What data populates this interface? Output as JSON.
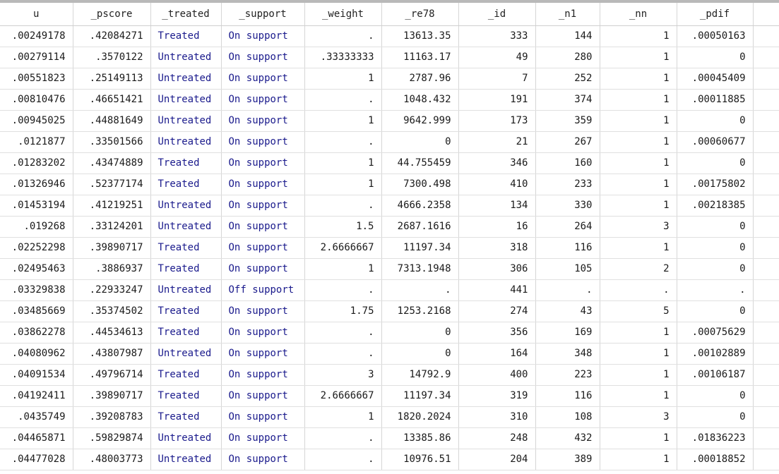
{
  "columns": [
    "u",
    "_pscore",
    "_treated",
    "_support",
    "_weight",
    "_re78",
    "_id",
    "_n1",
    "_nn",
    "_pdif"
  ],
  "rows": [
    [
      ".00249178",
      ".42084271",
      "Treated",
      "On support",
      ".",
      "13613.35",
      "333",
      "144",
      "1",
      ".00050163"
    ],
    [
      ".00279114",
      ".3570122",
      "Untreated",
      "On support",
      ".33333333",
      "11163.17",
      "49",
      "280",
      "1",
      "0"
    ],
    [
      ".00551823",
      ".25149113",
      "Untreated",
      "On support",
      "1",
      "2787.96",
      "7",
      "252",
      "1",
      ".00045409"
    ],
    [
      ".00810476",
      ".46651421",
      "Untreated",
      "On support",
      ".",
      "1048.432",
      "191",
      "374",
      "1",
      ".00011885"
    ],
    [
      ".00945025",
      ".44881649",
      "Untreated",
      "On support",
      "1",
      "9642.999",
      "173",
      "359",
      "1",
      "0"
    ],
    [
      ".0121877",
      ".33501566",
      "Untreated",
      "On support",
      ".",
      "0",
      "21",
      "267",
      "1",
      ".00060677"
    ],
    [
      ".01283202",
      ".43474889",
      "Treated",
      "On support",
      "1",
      "44.755459",
      "346",
      "160",
      "1",
      "0"
    ],
    [
      ".01326946",
      ".52377174",
      "Treated",
      "On support",
      "1",
      "7300.498",
      "410",
      "233",
      "1",
      ".00175802"
    ],
    [
      ".01453194",
      ".41219251",
      "Untreated",
      "On support",
      ".",
      "4666.2358",
      "134",
      "330",
      "1",
      ".00218385"
    ],
    [
      ".019268",
      ".33124201",
      "Untreated",
      "On support",
      "1.5",
      "2687.1616",
      "16",
      "264",
      "3",
      "0"
    ],
    [
      ".02252298",
      ".39890717",
      "Treated",
      "On support",
      "2.6666667",
      "11197.34",
      "318",
      "116",
      "1",
      "0"
    ],
    [
      ".02495463",
      ".3886937",
      "Treated",
      "On support",
      "1",
      "7313.1948",
      "306",
      "105",
      "2",
      "0"
    ],
    [
      ".03329838",
      ".22933247",
      "Untreated",
      "Off support",
      ".",
      ".",
      "441",
      ".",
      ".",
      "."
    ],
    [
      ".03485669",
      ".35374502",
      "Treated",
      "On support",
      "1.75",
      "1253.2168",
      "274",
      "43",
      "5",
      "0"
    ],
    [
      ".03862278",
      ".44534613",
      "Treated",
      "On support",
      ".",
      "0",
      "356",
      "169",
      "1",
      ".00075629"
    ],
    [
      ".04080962",
      ".43807987",
      "Untreated",
      "On support",
      ".",
      "0",
      "164",
      "348",
      "1",
      ".00102889"
    ],
    [
      ".04091534",
      ".49796714",
      "Treated",
      "On support",
      "3",
      "14792.9",
      "400",
      "223",
      "1",
      ".00106187"
    ],
    [
      ".04192411",
      ".39890717",
      "Treated",
      "On support",
      "2.6666667",
      "11197.34",
      "319",
      "116",
      "1",
      "0"
    ],
    [
      ".0435749",
      ".39208783",
      "Treated",
      "On support",
      "1",
      "1820.2024",
      "310",
      "108",
      "3",
      "0"
    ],
    [
      ".04465871",
      ".59829874",
      "Untreated",
      "On support",
      ".",
      "13385.86",
      "248",
      "432",
      "1",
      ".01836223"
    ],
    [
      ".04477028",
      ".48003773",
      "Untreated",
      "On support",
      ".",
      "10976.51",
      "204",
      "389",
      "1",
      ".00018852"
    ]
  ],
  "colors": {
    "label_text": "#1a1a8c",
    "grid_line": "#d6d6d6",
    "header_border": "#b9b9b9"
  }
}
